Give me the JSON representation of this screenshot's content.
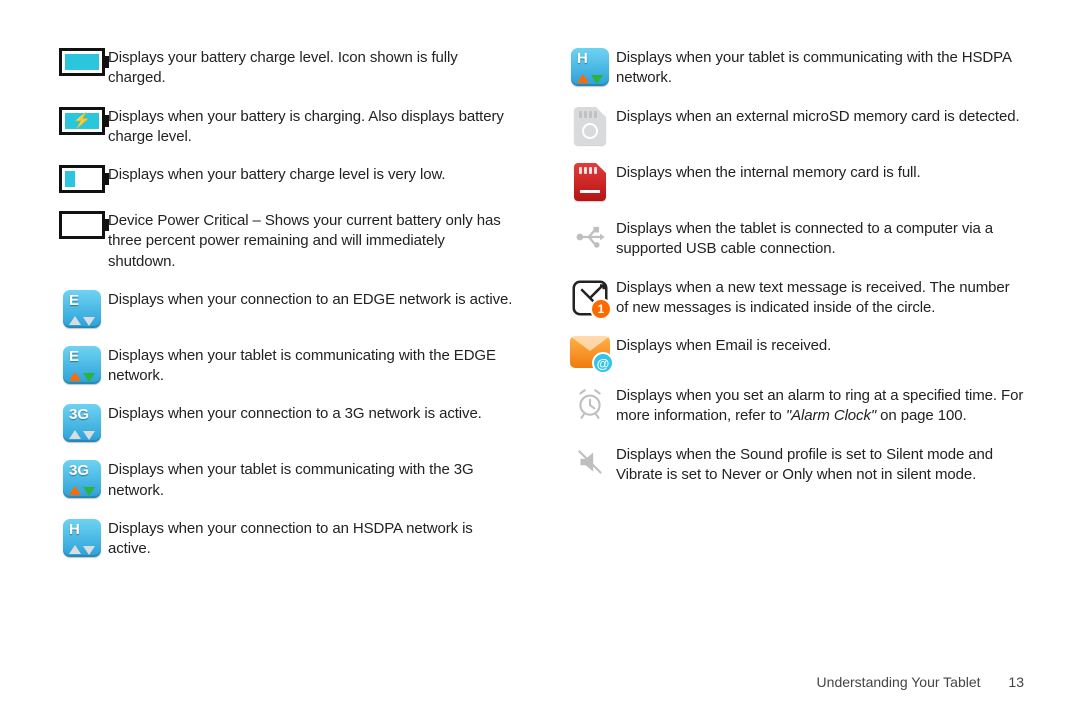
{
  "left": [
    {
      "icon": "battery-full",
      "text": "Displays your battery charge level. Icon shown is fully charged."
    },
    {
      "icon": "battery-charging",
      "text": "Displays when your battery is charging. Also displays battery charge level."
    },
    {
      "icon": "battery-low",
      "text": "Displays when your battery charge level is very low."
    },
    {
      "icon": "battery-critical",
      "text": "Device Power Critical – Shows your current battery only has three percent power remaining and will immediately shutdown."
    },
    {
      "icon": "edge-idle",
      "text": "Displays when your connection to an EDGE network is active."
    },
    {
      "icon": "edge-active",
      "text": "Displays when your tablet is communicating with the EDGE network."
    },
    {
      "icon": "3g-idle",
      "text": "Displays when your connection to a 3G network is active."
    },
    {
      "icon": "3g-active",
      "text": "Displays when your tablet is communicating with the 3G network."
    },
    {
      "icon": "hsdpa-idle",
      "text": "Displays when your connection to an HSDPA network is active."
    }
  ],
  "right": [
    {
      "icon": "hsdpa-active",
      "text": "Displays when your tablet is communicating with the HSDPA network."
    },
    {
      "icon": "sd-detected",
      "text": "Displays when an external microSD memory card is detected."
    },
    {
      "icon": "sd-full",
      "text": "Displays when the internal memory card is full."
    },
    {
      "icon": "usb",
      "text": "Displays when the tablet is connected to a computer via a supported USB cable connection."
    },
    {
      "icon": "message",
      "badge": "1",
      "text": "Displays when a new text message is received. The number of new messages is indicated inside of the circle."
    },
    {
      "icon": "email",
      "badge": "@",
      "text": "Displays when Email is received."
    },
    {
      "icon": "alarm",
      "text_pre": "Displays when you set an alarm to ring at a specified time. For more information, refer to ",
      "ref": "\"Alarm Clock\"",
      "text_post": " on page 100."
    },
    {
      "icon": "mute",
      "text": "Displays when the Sound profile is set to Silent mode and Vibrate is set to Never or Only when not in silent mode."
    }
  ],
  "footer": {
    "section": "Understanding Your Tablet",
    "page": "13"
  }
}
